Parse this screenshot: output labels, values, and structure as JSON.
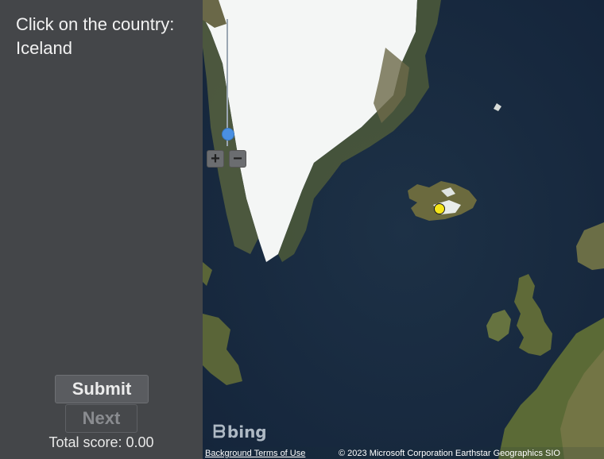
{
  "quiz": {
    "prompt": "Click on the country: Iceland",
    "submit_label": "Submit",
    "next_label": "Next",
    "score_text": "Total score: 0.00"
  },
  "map": {
    "zoom_in_symbol": "+",
    "zoom_out_symbol": "−",
    "provider_logo": "bing",
    "terms_link": "Background Terms of Use",
    "copyright": "© 2023 Microsoft Corporation Earthstar Geographics SIO",
    "marker_color": "#f5e51a",
    "ocean_color": "#1a2b3e",
    "ice_color": "#ffffff",
    "land_color": "#5c6a3e"
  }
}
